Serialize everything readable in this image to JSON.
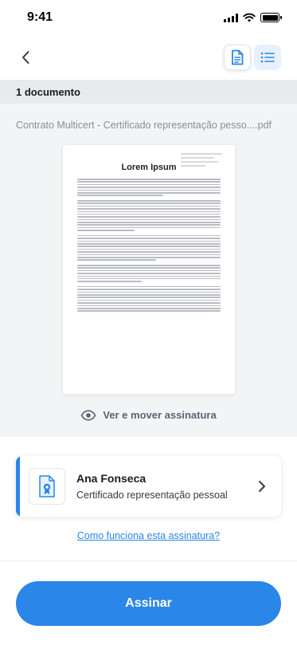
{
  "status_bar": {
    "time": "9:41"
  },
  "nav": {
    "back_icon": "chevron-left-icon",
    "document_view_icon": "document-icon",
    "list_view_icon": "list-icon"
  },
  "header": {
    "count_label": "1 documento"
  },
  "document": {
    "filename": "Contrato Multicert - Certificado representação pesso....pdf",
    "preview_title": "Lorem Ipsum",
    "view_move_label": "Ver e mover assinatura",
    "view_move_icon": "eye-icon"
  },
  "signer": {
    "name": "Ana Fonseca",
    "certificate": "Certificado representação pessoal",
    "icon": "certificate-icon",
    "chevron_icon": "chevron-right-icon"
  },
  "help_link": "Como funciona esta assinatura?",
  "sign_button": "Assinar",
  "colors": {
    "accent": "#2a86e8",
    "header_bg": "#e8eaed",
    "section_bg": "#f3f4f6"
  }
}
